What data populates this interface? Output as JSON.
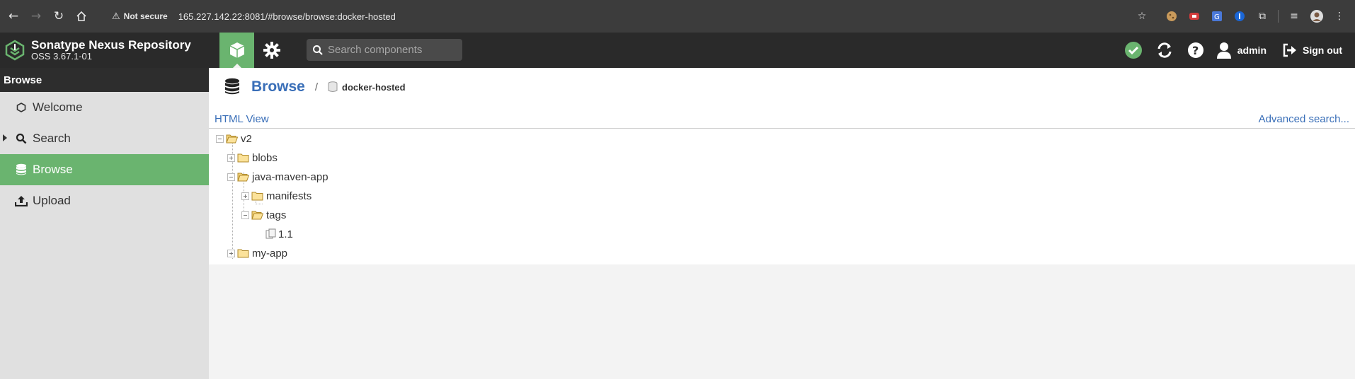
{
  "browser": {
    "security_label": "Not secure",
    "url": "165.227.142.22:8081/#browse/browse:docker-hosted"
  },
  "header": {
    "product_name": "Sonatype Nexus Repository",
    "version": "OSS 3.67.1-01",
    "search_placeholder": "Search components",
    "user": "admin",
    "sign_out": "Sign out"
  },
  "sidebar": {
    "title": "Browse",
    "items": [
      {
        "label": "Welcome",
        "icon": "hexagon-icon"
      },
      {
        "label": "Search",
        "icon": "search-icon"
      },
      {
        "label": "Browse",
        "icon": "database-icon"
      },
      {
        "label": "Upload",
        "icon": "upload-icon"
      }
    ]
  },
  "main": {
    "title": "Browse",
    "breadcrumb_separator": "/",
    "repository": "docker-hosted",
    "html_view": "HTML View",
    "advanced_search": "Advanced search...",
    "tree": {
      "root": "v2",
      "blobs": "blobs",
      "java_maven_app": "java-maven-app",
      "manifests": "manifests",
      "tags": "tags",
      "tag_1_1": "1.1",
      "my_app": "my-app"
    }
  },
  "colors": {
    "accent_green": "#6ab46f",
    "link_blue": "#3a6fb8",
    "header_dark": "#2a2a2a",
    "chrome_gray": "#3c3c3c"
  }
}
